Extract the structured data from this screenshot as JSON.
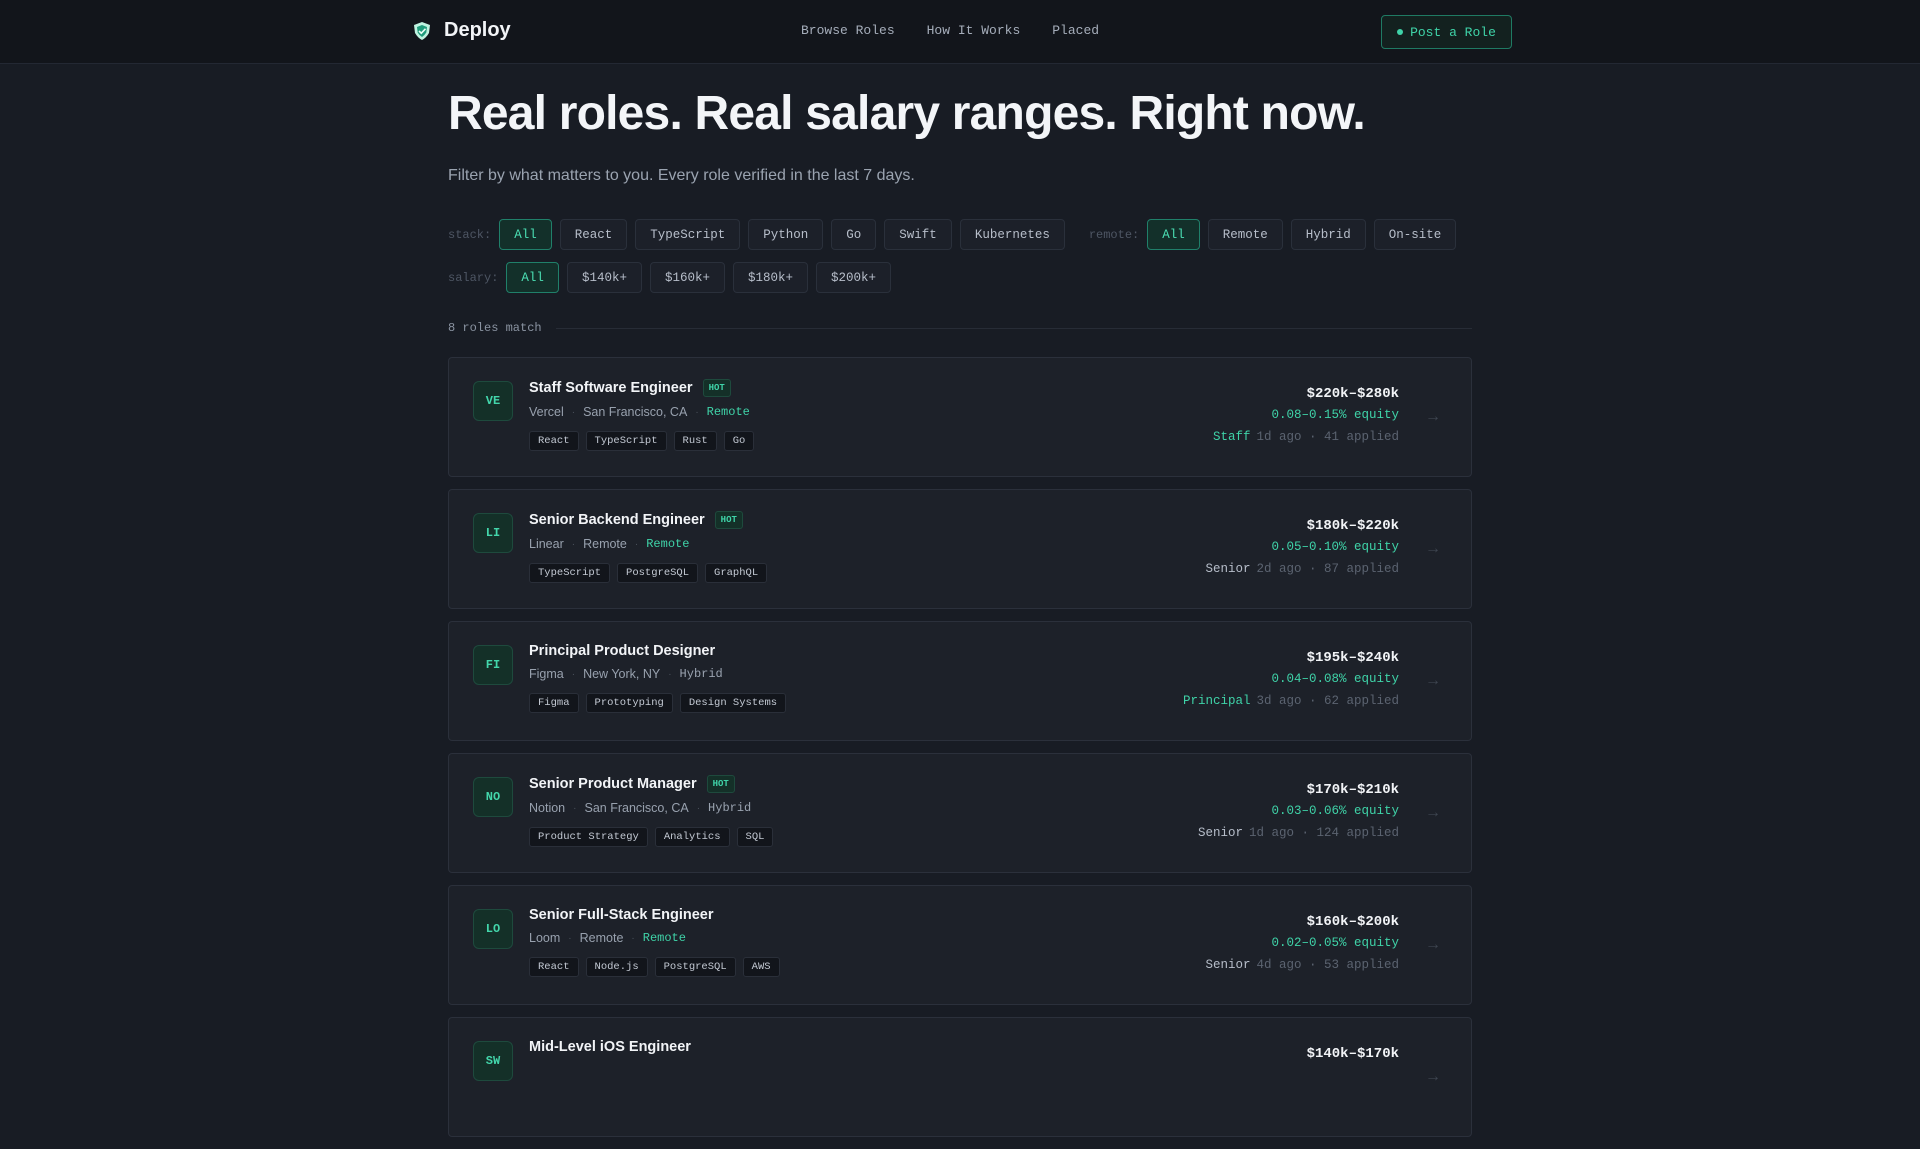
{
  "nav": {
    "brand": "Deploy",
    "links": [
      "Browse Roles",
      "How It Works",
      "Placed"
    ],
    "post_button": "Post a Role"
  },
  "hero": {
    "title": "Real roles. Real salary ranges. Right now.",
    "subtitle": "Filter by what matters to you. Every role verified in the last 7 days."
  },
  "filters": {
    "stack_label": "stack:",
    "stack": [
      "All",
      "React",
      "TypeScript",
      "Python",
      "Go",
      "Swift",
      "Kubernetes"
    ],
    "stack_selected": "All",
    "remote_label": "remote:",
    "remote": [
      "All",
      "Remote",
      "Hybrid",
      "On-site"
    ],
    "remote_selected": "All",
    "salary_label": "salary:",
    "salary": [
      "All",
      "$140k+",
      "$160k+",
      "$180k+",
      "$200k+"
    ],
    "salary_selected": "All"
  },
  "results": {
    "count_text": "8 roles match"
  },
  "jobs": [
    {
      "initials": "VE",
      "title": "Staff Software Engineer",
      "hot": true,
      "hot_label": "HOT",
      "company": "Vercel",
      "location": "San Francisco, CA",
      "mode": "Remote",
      "tags": [
        "React",
        "TypeScript",
        "Rust",
        "Go"
      ],
      "salary": "$220k–$280k",
      "equity": "0.08–0.15% equity",
      "level": "Staff",
      "posted": "1d ago",
      "applied": "41 applied"
    },
    {
      "initials": "LI",
      "title": "Senior Backend Engineer",
      "hot": true,
      "hot_label": "HOT",
      "company": "Linear",
      "location": "Remote",
      "mode": "Remote",
      "tags": [
        "TypeScript",
        "PostgreSQL",
        "GraphQL"
      ],
      "salary": "$180k–$220k",
      "equity": "0.05–0.10% equity",
      "level": "Senior",
      "posted": "2d ago",
      "applied": "87 applied"
    },
    {
      "initials": "FI",
      "title": "Principal Product Designer",
      "hot": false,
      "hot_label": "",
      "company": "Figma",
      "location": "New York, NY",
      "mode": "Hybrid",
      "tags": [
        "Figma",
        "Prototyping",
        "Design Systems"
      ],
      "salary": "$195k–$240k",
      "equity": "0.04–0.08% equity",
      "level": "Principal",
      "posted": "3d ago",
      "applied": "62 applied"
    },
    {
      "initials": "NO",
      "title": "Senior Product Manager",
      "hot": true,
      "hot_label": "HOT",
      "company": "Notion",
      "location": "San Francisco, CA",
      "mode": "Hybrid",
      "tags": [
        "Product Strategy",
        "Analytics",
        "SQL"
      ],
      "salary": "$170k–$210k",
      "equity": "0.03–0.06% equity",
      "level": "Senior",
      "posted": "1d ago",
      "applied": "124 applied"
    },
    {
      "initials": "LO",
      "title": "Senior Full-Stack Engineer",
      "hot": false,
      "hot_label": "",
      "company": "Loom",
      "location": "Remote",
      "mode": "Remote",
      "tags": [
        "React",
        "Node.js",
        "PostgreSQL",
        "AWS"
      ],
      "salary": "$160k–$200k",
      "equity": "0.02–0.05% equity",
      "level": "Senior",
      "posted": "4d ago",
      "applied": "53 applied"
    },
    {
      "initials": "SW",
      "title": "Mid-Level iOS Engineer",
      "hot": false,
      "hot_label": "",
      "company": "",
      "location": "",
      "mode": "",
      "tags": [],
      "salary": "$140k–$170k",
      "equity": "",
      "level": "",
      "posted": "",
      "applied": ""
    }
  ],
  "icons": {
    "brand_logo": "shield-logo-icon",
    "post_dot": "dot-icon",
    "row_arrow": "arrow-right-icon",
    "meta_separator": "·"
  },
  "colors": {
    "accent": "#3fd3a8",
    "background": "#181c24",
    "nav_bg": "#12151b",
    "card_bg": "#1d2129"
  }
}
